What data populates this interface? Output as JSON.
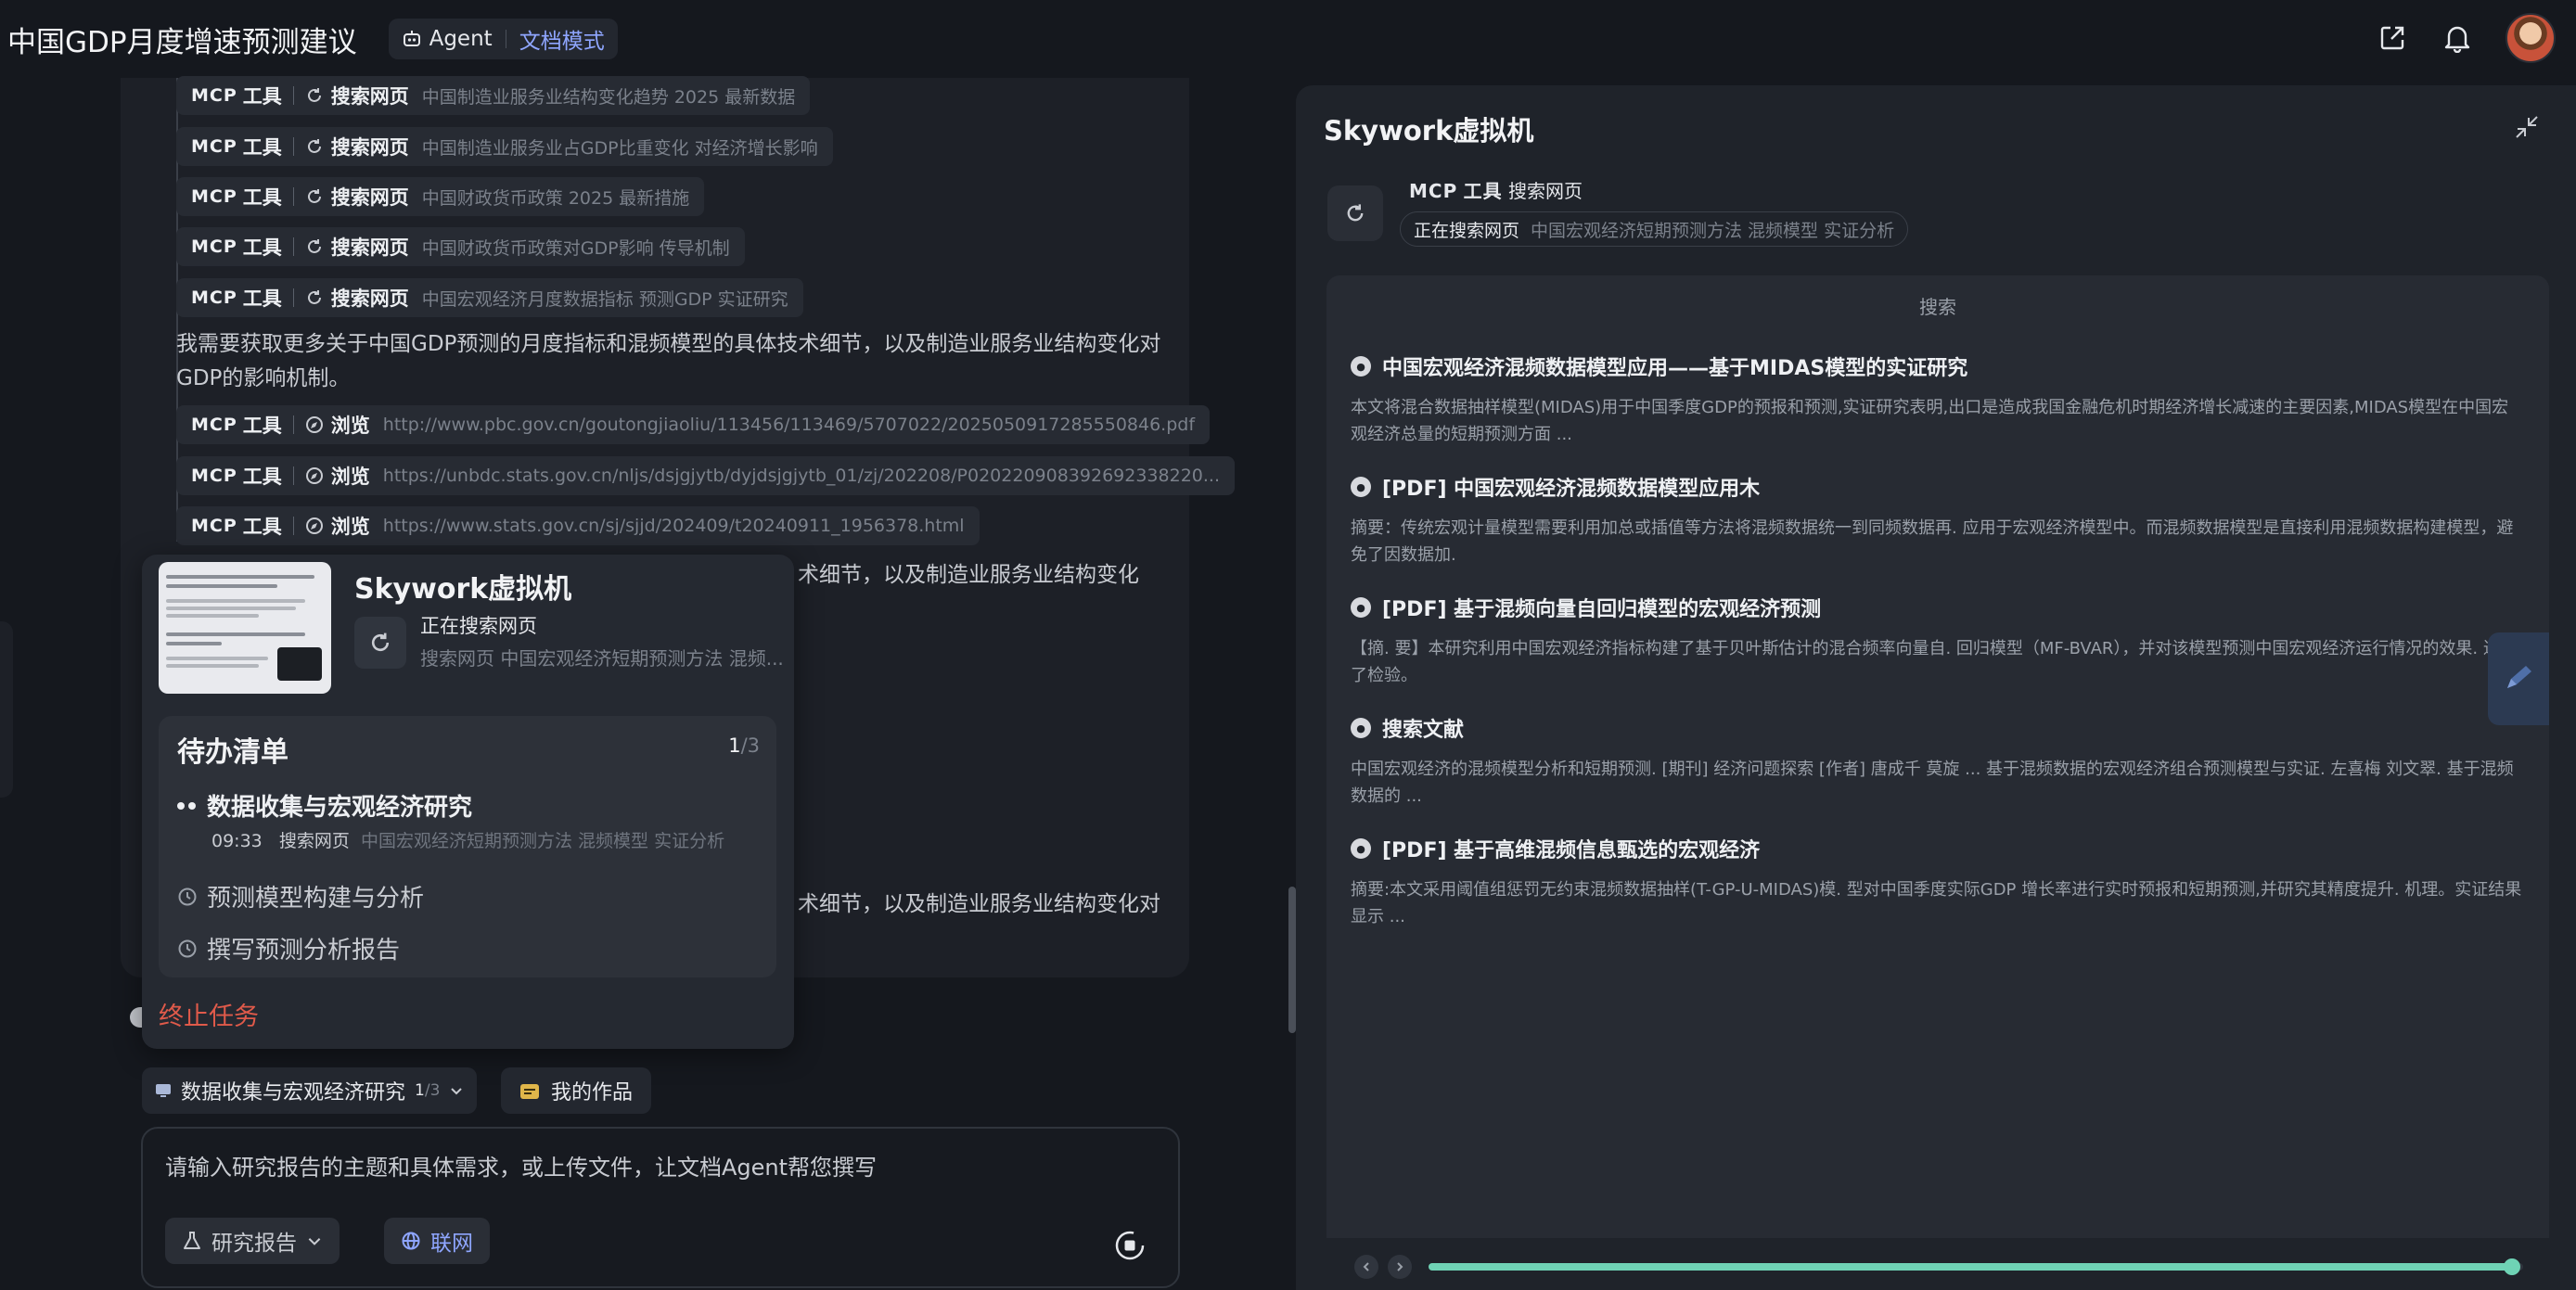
{
  "header": {
    "title": "中国GDP月度增速预测建议",
    "agent_label": "Agent",
    "mode_label": "文档模式",
    "icons": [
      "share-icon",
      "bell-icon"
    ],
    "accent": "#8fa6ff"
  },
  "chat": {
    "mcp_label": "MCP",
    "tool_label": "工具",
    "tool_calls": [
      {
        "action": "搜索网页",
        "query": "中国制造业服务业结构变化趋势 2025 最新数据",
        "icon": "refresh-icon"
      },
      {
        "action": "搜索网页",
        "query": "中国制造业服务业占GDP比重变化 对经济增长影响",
        "icon": "refresh-icon"
      },
      {
        "action": "搜索网页",
        "query": "中国财政货币政策 2025 最新措施",
        "icon": "refresh-icon"
      },
      {
        "action": "搜索网页",
        "query": "中国财政货币政策对GDP影响 传导机制",
        "icon": "refresh-icon"
      },
      {
        "action": "搜索网页",
        "query": "中国宏观经济月度数据指标 预测GDP 实证研究",
        "icon": "refresh-icon"
      },
      {
        "action": "浏览",
        "query": "http://www.pbc.gov.cn/goutongjiaoliu/113456/113469/5707022/2025050917285550846.pdf",
        "icon": "compass-icon"
      },
      {
        "action": "浏览",
        "query": "https://unbdc.stats.gov.cn/nljs/dsjgjytb/dyjdsjgjytb_01/zj/202208/P020220908392692338220...",
        "icon": "compass-icon"
      },
      {
        "action": "浏览",
        "query": "https://www.stats.gov.cn/sj/sjjd/202409/t20240911_1956378.html",
        "icon": "compass-icon"
      }
    ],
    "message": "我需要获取更多关于中国GDP预测的月度指标和混频模型的具体技术细节，以及制造业服务业结构变化对GDP的影响机制。",
    "fragment_1": "术细节，以及制造业服务业结构变化",
    "fragment_2": "术细节，以及制造业服务业结构变化对"
  },
  "popover": {
    "vm_title": "Skywork虚拟机",
    "vm_status": "正在搜索网页",
    "vm_query": "搜索网页 中国宏观经济短期预测方法 混频...",
    "todo_title": "待办清单",
    "todo_done": "1",
    "todo_total": "/3",
    "active_task": "数据收集与宏观经济研究",
    "active_time": "09:33",
    "active_action": "搜索网页",
    "active_query": "中国宏观经济短期预测方法 混频模型 实证分析",
    "pending_tasks": [
      "预测模型构建与分析",
      "撰写预测分析报告"
    ],
    "stop_label": "终止任务"
  },
  "composer": {
    "task_chip_label": "数据收集与宏观经济研究",
    "task_chip_done": "1",
    "task_chip_total": "/3",
    "works_label": "我的作品",
    "placeholder": "请输入研究报告的主题和具体需求，或上传文件，让文档Agent帮您撰写",
    "report_type": "研究报告",
    "web_label": "联网"
  },
  "vm": {
    "title": "Skywork虚拟机",
    "mcp_label": "MCP",
    "tool_label": "工具",
    "tool_action": "搜索网页",
    "status": "正在搜索网页",
    "query": "中国宏观经济短期预测方法 混频模型 实证分析",
    "browser_header": "搜索",
    "results": [
      {
        "title": "中国宏观经济混频数据模型应用——基于MIDAS模型的实证研究",
        "snippet": "本文将混合数据抽样模型(MIDAS)用于中国季度GDP的预报和预测,实证研究表明,出口是造成我国金融危机时期经济增长减速的主要因素,MIDAS模型在中国宏观经济总量的短期预测方面 ..."
      },
      {
        "title": "[PDF] 中国宏观经济混频数据模型应用木",
        "snippet": "摘要：传统宏观计量模型需要利用加总或插值等方法将混频数据统一到同频数据再. 应用于宏观经济模型中。而混频数据模型是直接利用混频数据构建模型，避免了因数据加."
      },
      {
        "title": "[PDF] 基于混频向量自回归模型的宏观经济预测",
        "snippet": "【摘. 要】本研究利用中国宏观经济指标构建了基于贝叶斯估计的混合频率向量自. 回归模型（MF-BVAR），并对该模型预测中国宏观经济运行情况的效果. 进行了检验。"
      },
      {
        "title": "搜索文献",
        "snippet": "中国宏观经济的混频模型分析和短期预测. [期刊] 经济问题探索 [作者] 唐成千 莫旋 ... 基于混频数据的宏观经济组合预测模型与实证. 左喜梅 刘文翠. 基于混频数据的 ..."
      },
      {
        "title": "[PDF] 基于高维混频信息甄选的宏观经济",
        "snippet": "摘要:本文采用阈值组惩罚无约束混频数据抽样(T-GP-U-MIDAS)模. 型对中国季度实际GDP 增长率进行实时预报和短期预测,并研究其精度提升. 机理。实证结果显示 ..."
      }
    ],
    "playback_progress": 0.99,
    "progress_color": "#6fd3b5"
  }
}
